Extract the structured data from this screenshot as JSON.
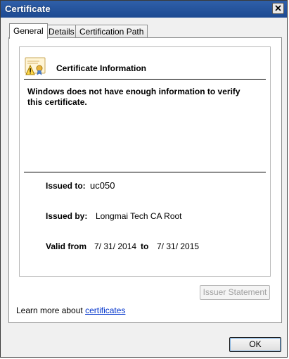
{
  "window": {
    "title": "Certificate"
  },
  "tabs": [
    {
      "label": "General",
      "active": true
    },
    {
      "label": "Details",
      "active": false
    },
    {
      "label": "Certification Path",
      "active": false
    }
  ],
  "general": {
    "heading": "Certificate Information",
    "warning": "Windows does not have enough information to verify this certificate.",
    "issued_to_label": "Issued to:",
    "issued_to_value": "uc050",
    "issued_by_label": "Issued by:",
    "issued_by_value": "Longmai Tech CA Root",
    "valid_from_label": "Valid from",
    "valid_from_value": "7/ 31/ 2014",
    "valid_to_label": "to",
    "valid_to_value": "7/ 31/ 2015"
  },
  "footer": {
    "issuer_statement_label": "Issuer Statement",
    "learn_more_prefix": "Learn more about ",
    "learn_more_link": "certificates",
    "ok_label": "OK"
  },
  "icons": {
    "close": "close-icon",
    "certificate": "certificate-warning-icon"
  },
  "colors": {
    "titlebar": "#1d4a92",
    "link": "#0033cc",
    "panel_border": "#8e8f8f"
  }
}
